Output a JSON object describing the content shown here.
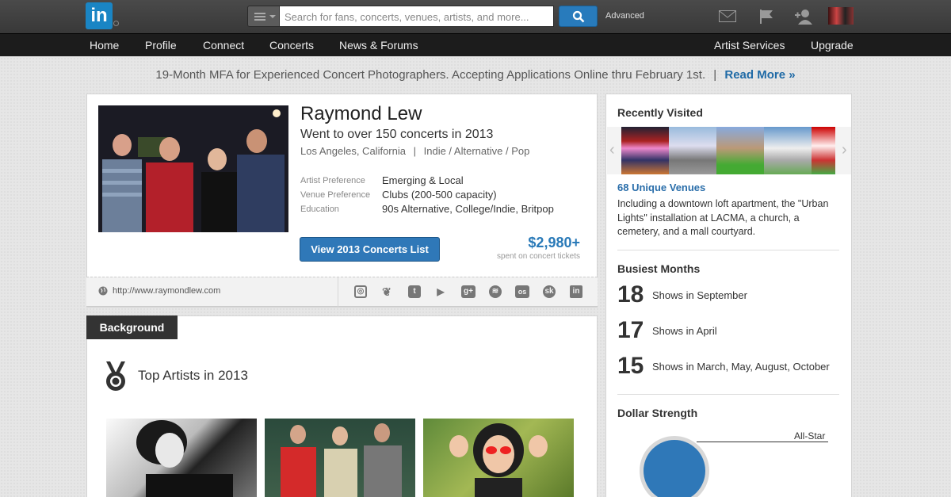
{
  "header": {
    "logo": "in",
    "search_placeholder": "Search for fans, concerts, venues, artists, and more...",
    "advanced": "Advanced",
    "icons": [
      "mail-icon",
      "flag-icon",
      "add-connection-icon",
      "avatar"
    ]
  },
  "nav": {
    "items": [
      "Home",
      "Profile",
      "Connect",
      "Concerts",
      "News & Forums"
    ],
    "right": [
      "Artist Services",
      "Upgrade"
    ]
  },
  "banner": {
    "text": "19-Month MFA for Experienced Concert Photographers. Accepting Applications Online thru February 1st.",
    "sep": "|",
    "link": "Read More »"
  },
  "profile": {
    "name": "Raymond Lew",
    "headline": "Went to over 150 concerts in 2013",
    "location": "Los Angeles, California",
    "sep": "|",
    "genres": "Indie / Alternative / Pop",
    "details": [
      {
        "label": "Artist Preference",
        "value": "Emerging & Local"
      },
      {
        "label": "Venue Preference",
        "value": "Clubs (200-500 capacity)"
      },
      {
        "label": "Education",
        "value": "90s Alternative, College/Indie, Britpop"
      }
    ],
    "button": "View 2013 Concerts List",
    "amount": "$2,980+",
    "amount_caption": "spent on concert tickets",
    "url": "http://www.raymondlew.com",
    "social_icons": [
      "instagram-icon",
      "twitter-icon",
      "tumblr-icon",
      "youtube-icon",
      "google-plus-icon",
      "spotify-icon",
      "lastfm-icon",
      "songkick-icon",
      "linkedin-icon"
    ]
  },
  "background": {
    "tab": "Background",
    "section_title": "Top Artists in 2013"
  },
  "sidebar": {
    "recent_title": "Recently Visited",
    "venues_link": "68 Unique Venues",
    "venues_desc": "Including a downtown loft apartment, the \"Urban Lights\" installation at LACMA, a church, a cemetery, and a mall courtyard.",
    "busiest_title": "Busiest Months",
    "months": [
      {
        "num": "18",
        "text": "Shows in September"
      },
      {
        "num": "17",
        "text": "Shows in April"
      },
      {
        "num": "15",
        "text": "Shows in March, May, August, October"
      }
    ],
    "dollar_title": "Dollar Strength",
    "dollar_label": "All-Star"
  },
  "colors": {
    "accent": "#2f78b8",
    "link": "#2a6eaa",
    "nav_bg": "#1c1c1c"
  }
}
